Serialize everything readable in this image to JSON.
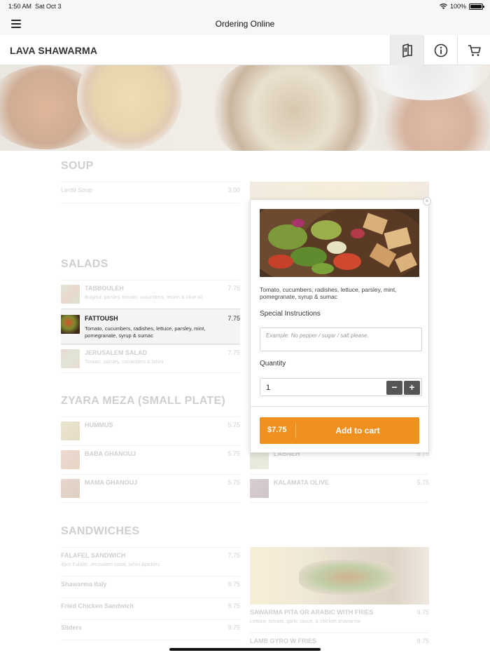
{
  "status": {
    "time": "1:50 AM",
    "date": "Sat Oct 3",
    "battery": "100%"
  },
  "nav": {
    "title": "Ordering Online"
  },
  "header": {
    "brand": "LAVA SHAWARMA"
  },
  "sections": {
    "soup": {
      "title": "SOUP",
      "items": [
        {
          "name": "Lentil Soup",
          "price": "3.00"
        }
      ]
    },
    "salads": {
      "title": "SALADS",
      "items": [
        {
          "name": "TABBOULEH",
          "desc": "Bulghur, parsley, tomato, cucumbers, lemon & olive oil",
          "price": "7.75"
        },
        {
          "name": "FATTOUSH",
          "desc": "Tomato, cucumbers, radishes, lettuce, parsley, mint, pomegranate, syrup & sumac",
          "price": "7.75"
        },
        {
          "name": "JERUSALEM SALAD",
          "desc": "Tomato, parsley, cucumbers & tahini",
          "price": "7.75"
        }
      ]
    },
    "meza": {
      "title": "ZYARA MEZA (SMALL PLATE)",
      "items": [
        {
          "name": "HUMMUS",
          "price": "5.75"
        },
        {
          "name": "BABA GHANOUJ",
          "price": "5.75"
        },
        {
          "name": "MAMA GHANOUJ",
          "price": "5.75"
        }
      ],
      "right_items": [
        {
          "name": "LABNEH",
          "price": "5.75"
        },
        {
          "name": "KALAMATA OLIVE",
          "price": "5.75"
        }
      ]
    },
    "sandwiches": {
      "title": "SANDWICHES",
      "items": [
        {
          "name": "FALAFEL SANDWICH",
          "desc": "4pcs Falafel, Jerusalem salad, tahini &pickles",
          "price": "7.75"
        },
        {
          "name": "Shawarma Italy",
          "price": "9.75"
        },
        {
          "name": "Fried Chicken Sandwich",
          "price": "9.75"
        },
        {
          "name": "Sliders",
          "price": "9.75"
        }
      ],
      "right_items": [
        {
          "name": "SAWARMA PITA OR ARABIC WITH FRIES",
          "desc": "Lettuce, tomato, garlic sauce, & chicken shawarma",
          "price": "9.75"
        },
        {
          "name": "LAMB GYRO W FRIES",
          "price": "9.75"
        }
      ]
    }
  },
  "popup": {
    "description": "Tomato, cucumbers, radishes, lettuce, parsley, mint, pomegranate, syrup & sumac",
    "special_label": "Special Instructions",
    "special_placeholder": "Example: No pepper / sugar / salt please.",
    "quantity_label": "Quantity",
    "quantity": "1",
    "price": "$7.75",
    "add_label": "Add to cart",
    "close_glyph": "×",
    "minus_glyph": "−",
    "plus_glyph": "+"
  },
  "colors": {
    "accent": "#f0901f",
    "stepper": "#555555"
  },
  "icons": {
    "menu": "hamburger-icon",
    "menu_book": "menu-book-icon",
    "info": "info-icon",
    "cart": "cart-icon",
    "wifi": "wifi-icon"
  }
}
